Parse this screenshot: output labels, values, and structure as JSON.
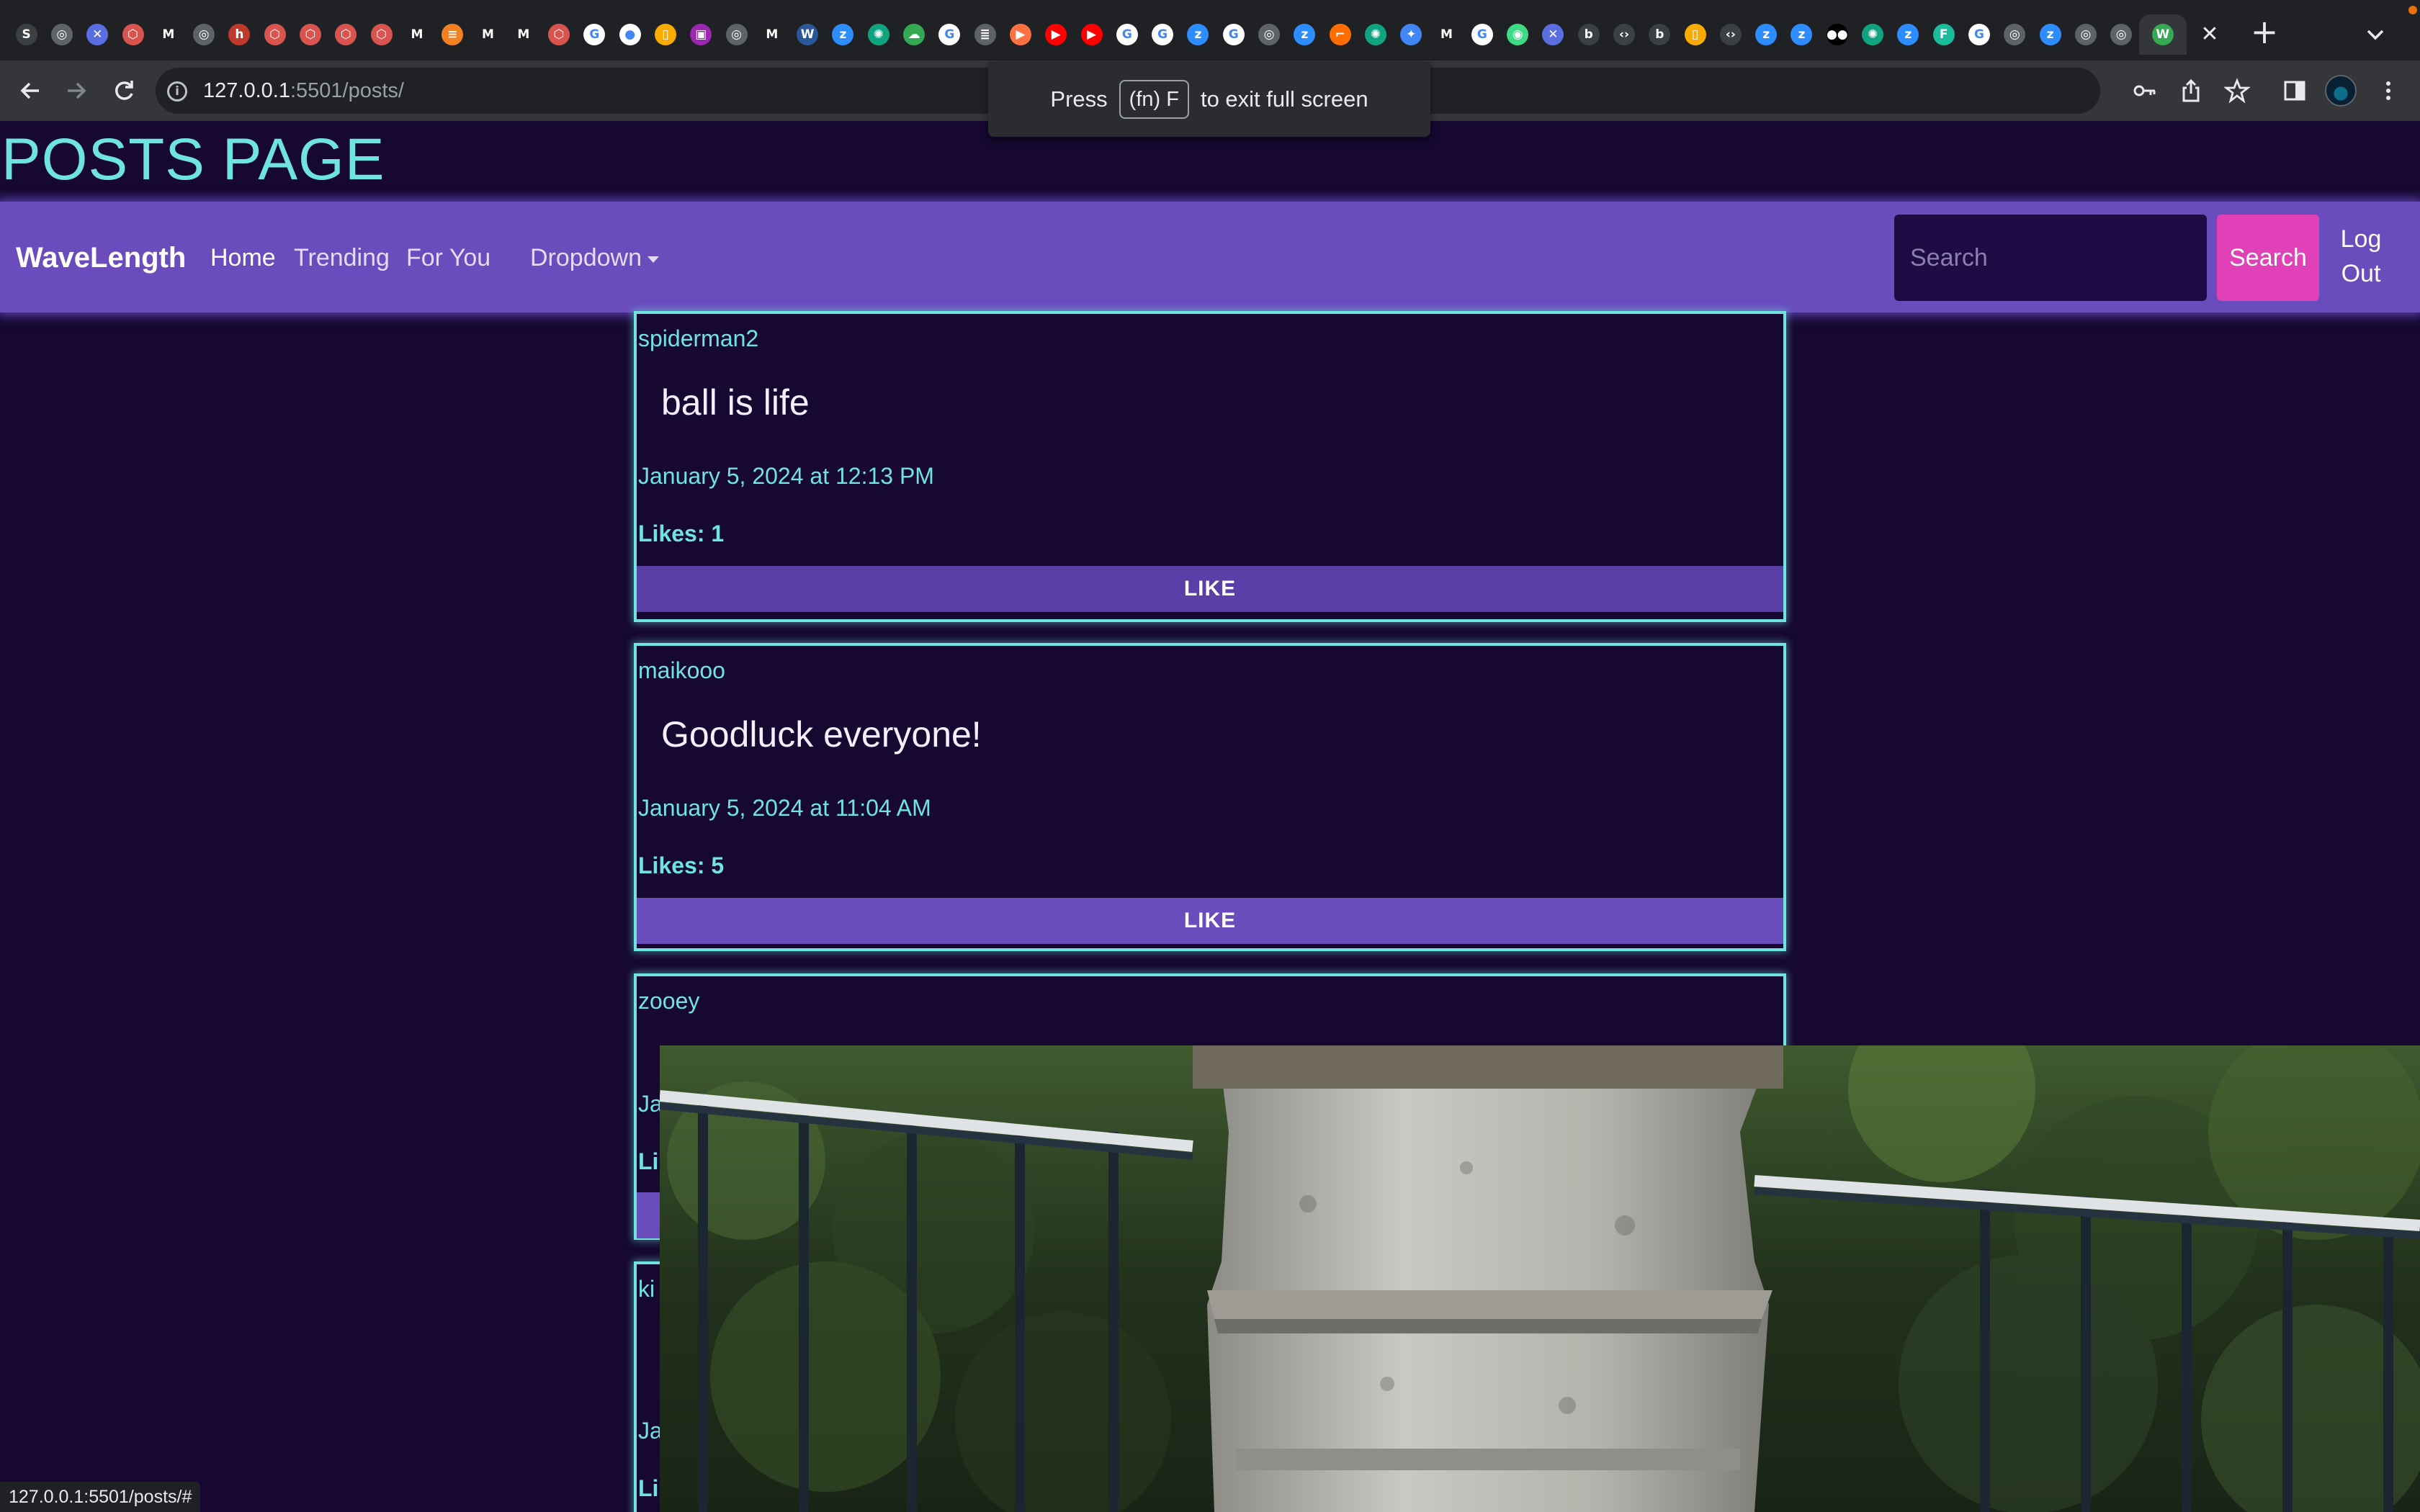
{
  "browser": {
    "url_host": "127.0.0.1",
    "url_path": ":5501/posts/",
    "status_url": "127.0.0.1:5501/posts/#",
    "tabs": [
      {
        "icon": "s-icon",
        "glyph": "S",
        "color": "#3c4043"
      },
      {
        "icon": "globe-icon",
        "glyph": "◎",
        "color": "#5f6368"
      },
      {
        "icon": "tools-icon",
        "glyph": "✕",
        "color": "#5b6ee1"
      },
      {
        "icon": "red-hex-icon",
        "glyph": "⬡",
        "color": "#d9534f"
      },
      {
        "icon": "medium-icon",
        "glyph": "M",
        "color": "#202124"
      },
      {
        "icon": "globe-icon",
        "glyph": "◎",
        "color": "#5f6368"
      },
      {
        "icon": "http-icon",
        "glyph": "h",
        "color": "#c0392b"
      },
      {
        "icon": "red-hex-icon",
        "glyph": "⬡",
        "color": "#d9534f"
      },
      {
        "icon": "red-hex-icon",
        "glyph": "⬡",
        "color": "#d9534f"
      },
      {
        "icon": "red-hex-icon",
        "glyph": "⬡",
        "color": "#d9534f"
      },
      {
        "icon": "red-hex-icon",
        "glyph": "⬡",
        "color": "#d9534f"
      },
      {
        "icon": "medium-icon",
        "glyph": "M",
        "color": "#202124"
      },
      {
        "icon": "stackoverflow-icon",
        "glyph": "≡",
        "color": "#f48024"
      },
      {
        "icon": "medium-icon",
        "glyph": "M",
        "color": "#202124"
      },
      {
        "icon": "medium-icon",
        "glyph": "M",
        "color": "#202124"
      },
      {
        "icon": "red-hex-icon",
        "glyph": "⬡",
        "color": "#d9534f"
      },
      {
        "icon": "google-icon",
        "glyph": "G",
        "color": "#ffffff"
      },
      {
        "icon": "github-icon",
        "glyph": "●",
        "color": "#ffffff"
      },
      {
        "icon": "doc-icon",
        "glyph": "▯",
        "color": "#f9ab00"
      },
      {
        "icon": "image-icon",
        "glyph": "▣",
        "color": "#9c27b0"
      },
      {
        "icon": "globe-icon",
        "glyph": "◎",
        "color": "#5f6368"
      },
      {
        "icon": "medium-icon",
        "glyph": "M",
        "color": "#202124"
      },
      {
        "icon": "word-icon",
        "glyph": "W",
        "color": "#2b579a"
      },
      {
        "icon": "zoom-icon",
        "glyph": "z",
        "color": "#2d8cff"
      },
      {
        "icon": "openai-icon",
        "glyph": "✺",
        "color": "#10a37f"
      },
      {
        "icon": "cloud-icon",
        "glyph": "☁",
        "color": "#34a853"
      },
      {
        "icon": "google-icon",
        "glyph": "G",
        "color": "#ffffff"
      },
      {
        "icon": "database-icon",
        "glyph": "≣",
        "color": "#5f6368"
      },
      {
        "icon": "orange-icon",
        "glyph": "▶",
        "color": "#ff7043"
      },
      {
        "icon": "youtube-icon",
        "glyph": "▶",
        "color": "#ff0000"
      },
      {
        "icon": "youtube-icon",
        "glyph": "▶",
        "color": "#ff0000"
      },
      {
        "icon": "google-icon",
        "glyph": "G",
        "color": "#ffffff"
      },
      {
        "icon": "google-icon",
        "glyph": "G",
        "color": "#ffffff"
      },
      {
        "icon": "zoom-icon",
        "glyph": "z",
        "color": "#2d8cff"
      },
      {
        "icon": "google-icon",
        "glyph": "G",
        "color": "#ffffff"
      },
      {
        "icon": "globe-icon",
        "glyph": "◎",
        "color": "#5f6368"
      },
      {
        "icon": "zoom-icon",
        "glyph": "z",
        "color": "#2d8cff"
      },
      {
        "icon": "bracket-icon",
        "glyph": "⌐",
        "color": "#ff6d00"
      },
      {
        "icon": "openai-icon",
        "glyph": "✺",
        "color": "#10a37f"
      },
      {
        "icon": "sparkle-icon",
        "glyph": "✦",
        "color": "#4285f4"
      },
      {
        "icon": "medium-icon",
        "glyph": "M",
        "color": "#202124"
      },
      {
        "icon": "google-icon",
        "glyph": "G",
        "color": "#ffffff"
      },
      {
        "icon": "android-icon",
        "glyph": "◉",
        "color": "#3ddc84"
      },
      {
        "icon": "tools-icon",
        "glyph": "✕",
        "color": "#5b6ee1"
      },
      {
        "icon": "b-icon",
        "glyph": "b",
        "color": "#3c4043"
      },
      {
        "icon": "code-icon",
        "glyph": "‹›",
        "color": "#3c4043"
      },
      {
        "icon": "b-icon",
        "glyph": "b",
        "color": "#3c4043"
      },
      {
        "icon": "doc-icon",
        "glyph": "▯",
        "color": "#f9ab00"
      },
      {
        "icon": "code-icon",
        "glyph": "‹›",
        "color": "#3c4043"
      },
      {
        "icon": "zoom-icon",
        "glyph": "z",
        "color": "#2d8cff"
      },
      {
        "icon": "zoom-icon",
        "glyph": "z",
        "color": "#2d8cff"
      },
      {
        "icon": "medium-dots-icon",
        "glyph": "●●",
        "color": "#000000"
      },
      {
        "icon": "openai-icon",
        "glyph": "✺",
        "color": "#10a37f"
      },
      {
        "icon": "zoom-icon",
        "glyph": "z",
        "color": "#2d8cff"
      },
      {
        "icon": "figma-icon",
        "glyph": "F",
        "color": "#1abc9c"
      },
      {
        "icon": "google-icon",
        "glyph": "G",
        "color": "#ffffff"
      },
      {
        "icon": "globe-icon",
        "glyph": "◎",
        "color": "#5f6368"
      },
      {
        "icon": "zoom-icon",
        "glyph": "z",
        "color": "#2d8cff"
      },
      {
        "icon": "globe-icon",
        "glyph": "◎",
        "color": "#5f6368"
      },
      {
        "icon": "globe-icon",
        "glyph": "◎",
        "color": "#5f6368"
      },
      {
        "icon": "w-icon",
        "glyph": "W",
        "color": "#34a853"
      }
    ]
  },
  "fullscreen_toast": {
    "before": "Press",
    "key": "(fn) F",
    "after": "to exit full screen"
  },
  "page": {
    "title": "POSTS PAGE"
  },
  "navbar": {
    "brand": "WaveLength",
    "links": {
      "home": "Home",
      "trending": "Trending",
      "for_you": "For You",
      "dropdown": "Dropdown"
    },
    "search_placeholder": "Search",
    "search_button": "Search",
    "logout": "Log Out"
  },
  "posts": [
    {
      "user": "spiderman2",
      "content": "ball is life",
      "date": "January 5, 2024 at 12:13 PM",
      "likes": "Likes: 1",
      "like_button": "LIKE"
    },
    {
      "user": "maikooo",
      "content": "Goodluck everyone!",
      "date": "January 5, 2024 at 11:04 AM",
      "likes": "Likes: 5",
      "like_button": "LIKE"
    },
    {
      "user": "zooey",
      "content": "",
      "date": "Ja",
      "likes": "Li",
      "like_button": ""
    },
    {
      "user": "ki",
      "content": "",
      "date": "Ja",
      "likes": "Li",
      "like_button": ""
    }
  ],
  "colors": {
    "page_bg": "#160830",
    "accent_cyan": "#6fe3e0",
    "navbar_purple": "#6a4cbd",
    "search_pink": "#e040b8"
  }
}
